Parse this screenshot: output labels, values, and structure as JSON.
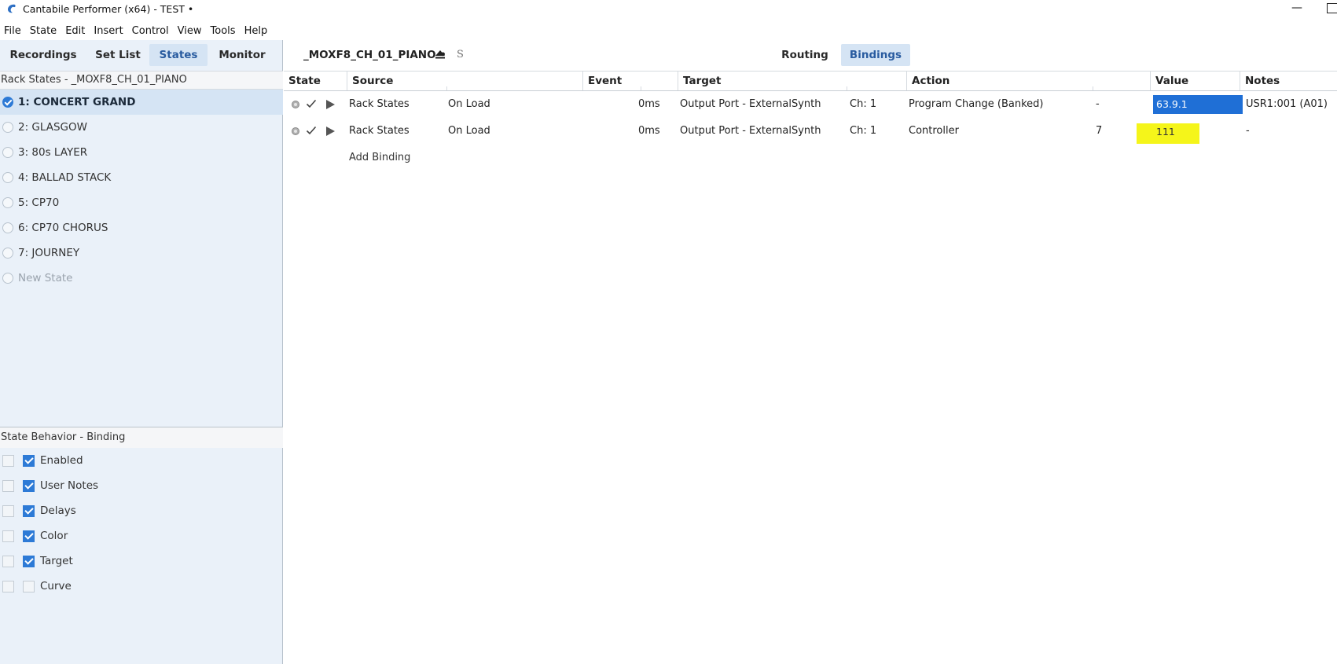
{
  "window": {
    "title": "Cantabile Performer (x64) - TEST •",
    "minimize_glyph": "—"
  },
  "menu": [
    "File",
    "State",
    "Edit",
    "Insert",
    "Control",
    "View",
    "Tools",
    "Help"
  ],
  "left_tabs": [
    {
      "label": "Recordings",
      "active": false
    },
    {
      "label": "Set List",
      "active": false
    },
    {
      "label": "States",
      "active": true
    },
    {
      "label": "Monitor",
      "active": false
    }
  ],
  "rack_states": {
    "header": "Rack States - _MOXF8_CH_01_PIANO",
    "items": [
      {
        "label": "1: CONCERT GRAND",
        "selected": true
      },
      {
        "label": "2: GLASGOW",
        "selected": false
      },
      {
        "label": "3: 80s LAYER",
        "selected": false
      },
      {
        "label": "4: BALLAD STACK",
        "selected": false
      },
      {
        "label": "5: CP70",
        "selected": false
      },
      {
        "label": "6: CP70 CHORUS",
        "selected": false
      },
      {
        "label": "7: JOURNEY",
        "selected": false
      }
    ],
    "new_state_label": "New State"
  },
  "state_behavior": {
    "header": "State Behavior - Binding",
    "items": [
      {
        "label": "Enabled",
        "checked": true
      },
      {
        "label": "User Notes",
        "checked": true
      },
      {
        "label": "Delays",
        "checked": true
      },
      {
        "label": "Color",
        "checked": true
      },
      {
        "label": "Target",
        "checked": true
      },
      {
        "label": "Curve",
        "checked": false
      }
    ]
  },
  "rack_toolbar": {
    "rack_name": "_MOXF8_CH_01_PIANO •",
    "s_label": "S",
    "tabs": [
      {
        "label": "Routing",
        "active": false
      },
      {
        "label": "Bindings",
        "active": true
      }
    ]
  },
  "grid": {
    "columns": [
      "State",
      "Source",
      "Event",
      "Target",
      "Action",
      "Value",
      "Notes"
    ],
    "rows": [
      {
        "source": "Rack States",
        "source_event": "On Load",
        "delay": "0ms",
        "target": "Output Port - ExternalSynth",
        "channel": "Ch: 1",
        "action": "Program Change (Banked)",
        "action_param": "-",
        "value": "63.9.1",
        "notes": "USR1:001 (A01)"
      },
      {
        "source": "Rack States",
        "source_event": "On Load",
        "delay": "0ms",
        "target": "Output Port - ExternalSynth",
        "channel": "Ch: 1",
        "action": "Controller",
        "action_param": "7",
        "value": "111",
        "notes": "-"
      }
    ],
    "add_binding_label": "Add Binding"
  },
  "colors": {
    "accent_blue": "#2d7ad6",
    "selected_row_bg": "#d5e4f4",
    "value_highlight_blue": "#1f6fd6",
    "value_highlight_yellow": "#f5f51a"
  }
}
